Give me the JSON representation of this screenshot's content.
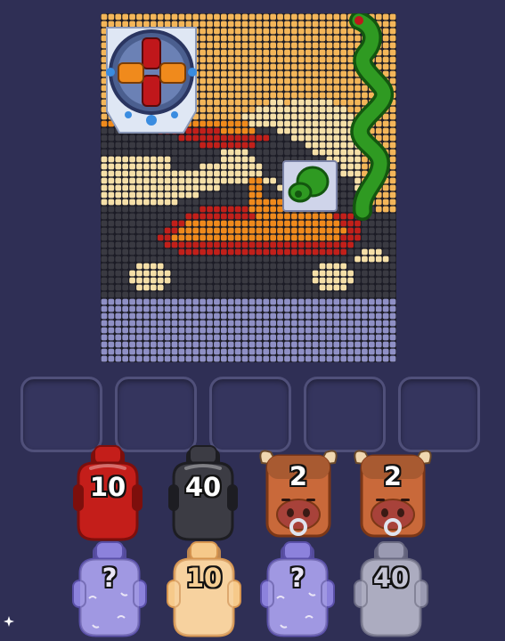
{
  "board": {
    "rows": [
      "YYYYYYYYYYYYYYYYYYYYYYYYYYYYYYYYYYYYYYYYYY",
      "YYYYYYYYYYYYYYYYYYYYYYYYYYYYYYYYYYYYYYYYYY",
      "YYYYYYYYYYYYYYYYYYYYYYYYYYYYYYYYYYYYYYYYYY",
      "YYYYYYYYYYYYYYYYYYYYYYYYYYYYYYYYYYYYYYYYYY",
      "YYYYYYYYYYYYYYYYYYYYYYYYYYYYYYYYYYYYYYYYYY",
      "YYYYYYYYYYYYYYYYYYYYYYYYYYYYYYYYYYYYYYYYYY",
      "YYYYYYYYYYYYYYYYYYYYYYYYYYYYYYYYYYYYYYYYYY",
      "YYYYYYYYYYYYYYYYYYYYYYYYYYYYYYYYYYYYYYYYYY",
      "YYYYYYYYYYYYYYYYYYYYYYYYYYYYYYYYYYYYYYYYYY",
      "YYYYYYYYYYYYYYYYYYYYYYYYYYYYYYYYYYYYYYYYYY",
      "YYYYYYYYYYYYYYYYYYYYYYYYYYYYYYYYYYYYYYYYYY",
      "YYYYYYYYYYYYYYYYYYYYYYYYYYYYYYYYYYYYYYYYYY",
      "YYYYYYYYYYYYYYYYYYYYYYYYWWYWWWWWWYYYYYYYYY",
      "YYYYYYYYYYYYYYYYYYYYYYWWWWWWWWWWWWWYYYYYYY",
      "YYYYYYYYYYYYYYYYYYYYWWWWWWWWWWWWWWWWYYYYYY",
      "OOOOOOOOOOOOOOOOOOOOOWWWWWWWWWWWWWWWWYYYYY",
      "KKKKKKKKRRRRRRRRROOOOOKKKWWWWWWWWWWWWYYYYY",
      "KKKKKKKKKKKRRRRRRRRRRRRRKKKWWWWWWWWWWYYYYY",
      "KKKKKKKKKKKKKKRRRRRRRRKKKKKKKWWWWWWWWYYYYY",
      "KKKKKKKKKKKKKKKKKWWWWKKKKKKKKKWWWWWWWYYYYY",
      "WWWWWWWWWWKKKKKKKWWWWWKKKKKKKKKKWWWWWYYYYY",
      "WWWWWWWWWWKKKKWWWWWWWWWKKKKKKKKKKKWWWYYYYY",
      "WWWWWWWWWWWWWWWWWWWWWWWKKKKKKKKKKKWWWYYYYY",
      "WWWWWWWWWWWWWWWWWWWWWOOWWKKKKKKKKKKKWYYYYY",
      "WWWWWWWWWWWWWWWWWKKKKOOKKWKKKKKKKKKKWYYYYY",
      "WWWWWWWWWWWWWWKKKKKKKOOKKKKKKKKKKKKKKKYYYY",
      "WWWWWWWWWWWKKKKKKKKKKOOOOOKKKKKKKKKKKKYYYY",
      "KKKKKKKKKKKKKKRRRRRRROOOOOOOOOOOKKKKKKKYYY",
      "KKKKKKKKKKKKRRRRRRRRRROOOOOOOOOOORRRKKKKKK",
      "KKKKKKKKKKRROOOOOOOOOOOOOOOOOOOOOORRRKKKKK",
      "KKKKKKKKKRROOOOOOOOOOOOOOOOOOOOOOOORRKKKKK",
      "KKKKKKKKRROOOOOOOOOOOOOOOOOOOOOOOORRRKKKKK",
      "KKKKKKKKKRRRRRRRRRRRRRRRRRRRRRRRRRRRKKKKKK",
      "KKKKKKKKKKKRRRRRRRRRRRRRRRRRRRRRRRRKKWWWKK",
      "KKKKKKKKKKKKKKKKKKKKKKKKKKKKKKKKKKKKWWWWWK",
      "KKKKKWWWWKKKKKKKKKKKKKKKKKKKKKKWWWWKKKKKKK",
      "KKKKWWWWWWKKKKKKKKKKKKKKKKKKKKWWWWWWKKKKKK",
      "KKKKWWWWWWKKKKKKKKKKKKKKKKKKKKWWWWWWKKKKKK",
      "KKKKKWWWWKKKKKKKKKKKKKKKKKKKKKKWWWWKKKKKKK",
      "KKKKKKKKKKKKKKKKKKKKKKKKKKKKKKKKKKKKKKKKKK",
      "PPPPPPPPPPPPPPPPPPPPPPPPPPPPPPPPPPPPPPPPPP",
      "PPPPPPPPPPPPPPPPPPPPPPPPPPPPPPPPPPPPPPPPPP",
      "PPPPPPPPPPPPPPPPPPPPPPPPPPPPPPPPPPPPPPPPPP",
      "PPPPPPPPPPPPPPPPPPPPPPPPPPPPPPPPPPPPPPPPPP",
      "PPPPPPPPPPPPPPPPPPPPPPPPPPPPPPPPPPPPPPPPPP",
      "PPPPPPPPPPPPPPPPPPPPPPPPPPPPPPPPPPPPPPPPPP",
      "PPPPPPPPPPPPPPPPPPPPPPPPPPPPPPPPPPPPPPPPPP",
      "PPPPPPPPPPPPPPPPPPPPPPPPPPPPPPPPPPPPPPPPPP",
      "PPPPPPPPPPPPPPPPPPPPPPPPPPPPPPPPPPPPPPPPPP"
    ],
    "palette": {
      "Y": "#f4b659",
      "W": "#f6e0a8",
      "O": "#f08a1c",
      "R": "#c2201a",
      "K": "#3a3a42",
      "P": "#8f90c6"
    }
  },
  "slots": {
    "count": 5
  },
  "queue": {
    "front": [
      {
        "kind": "blob",
        "color": "#c41e1a",
        "dark": "#7d0f0c",
        "count": "10",
        "icon": "red-blob-icon"
      },
      {
        "kind": "blob",
        "color": "#3c3c44",
        "dark": "#1d1d22",
        "count": "40",
        "icon": "black-blob-icon"
      },
      {
        "kind": "bull",
        "color": "#c9693a",
        "dark": "#7c3716",
        "count": "2",
        "icon": "bull-icon"
      },
      {
        "kind": "bull",
        "color": "#c9693a",
        "dark": "#7c3716",
        "count": "2",
        "icon": "bull-icon"
      }
    ],
    "back": [
      {
        "kind": "ghost",
        "color": "#8c82dc",
        "dark": "#5a50a8",
        "count": "?",
        "icon": "mystery-ghost-icon"
      },
      {
        "kind": "ghost",
        "color": "#f6c98a",
        "dark": "#d69550",
        "count": "10",
        "icon": "peach-ghost-icon"
      },
      {
        "kind": "ghost",
        "color": "#8c82dc",
        "dark": "#5a50a8",
        "count": "?",
        "icon": "mystery-ghost-icon"
      },
      {
        "kind": "ghost",
        "color": "#9a9ab2",
        "dark": "#6a6a82",
        "count": "40",
        "icon": "gray-ghost-icon"
      }
    ]
  },
  "icons": {
    "launcher": "cross-launcher-icon",
    "snake": "green-snake-icon",
    "cannon": "green-cannon-icon"
  }
}
